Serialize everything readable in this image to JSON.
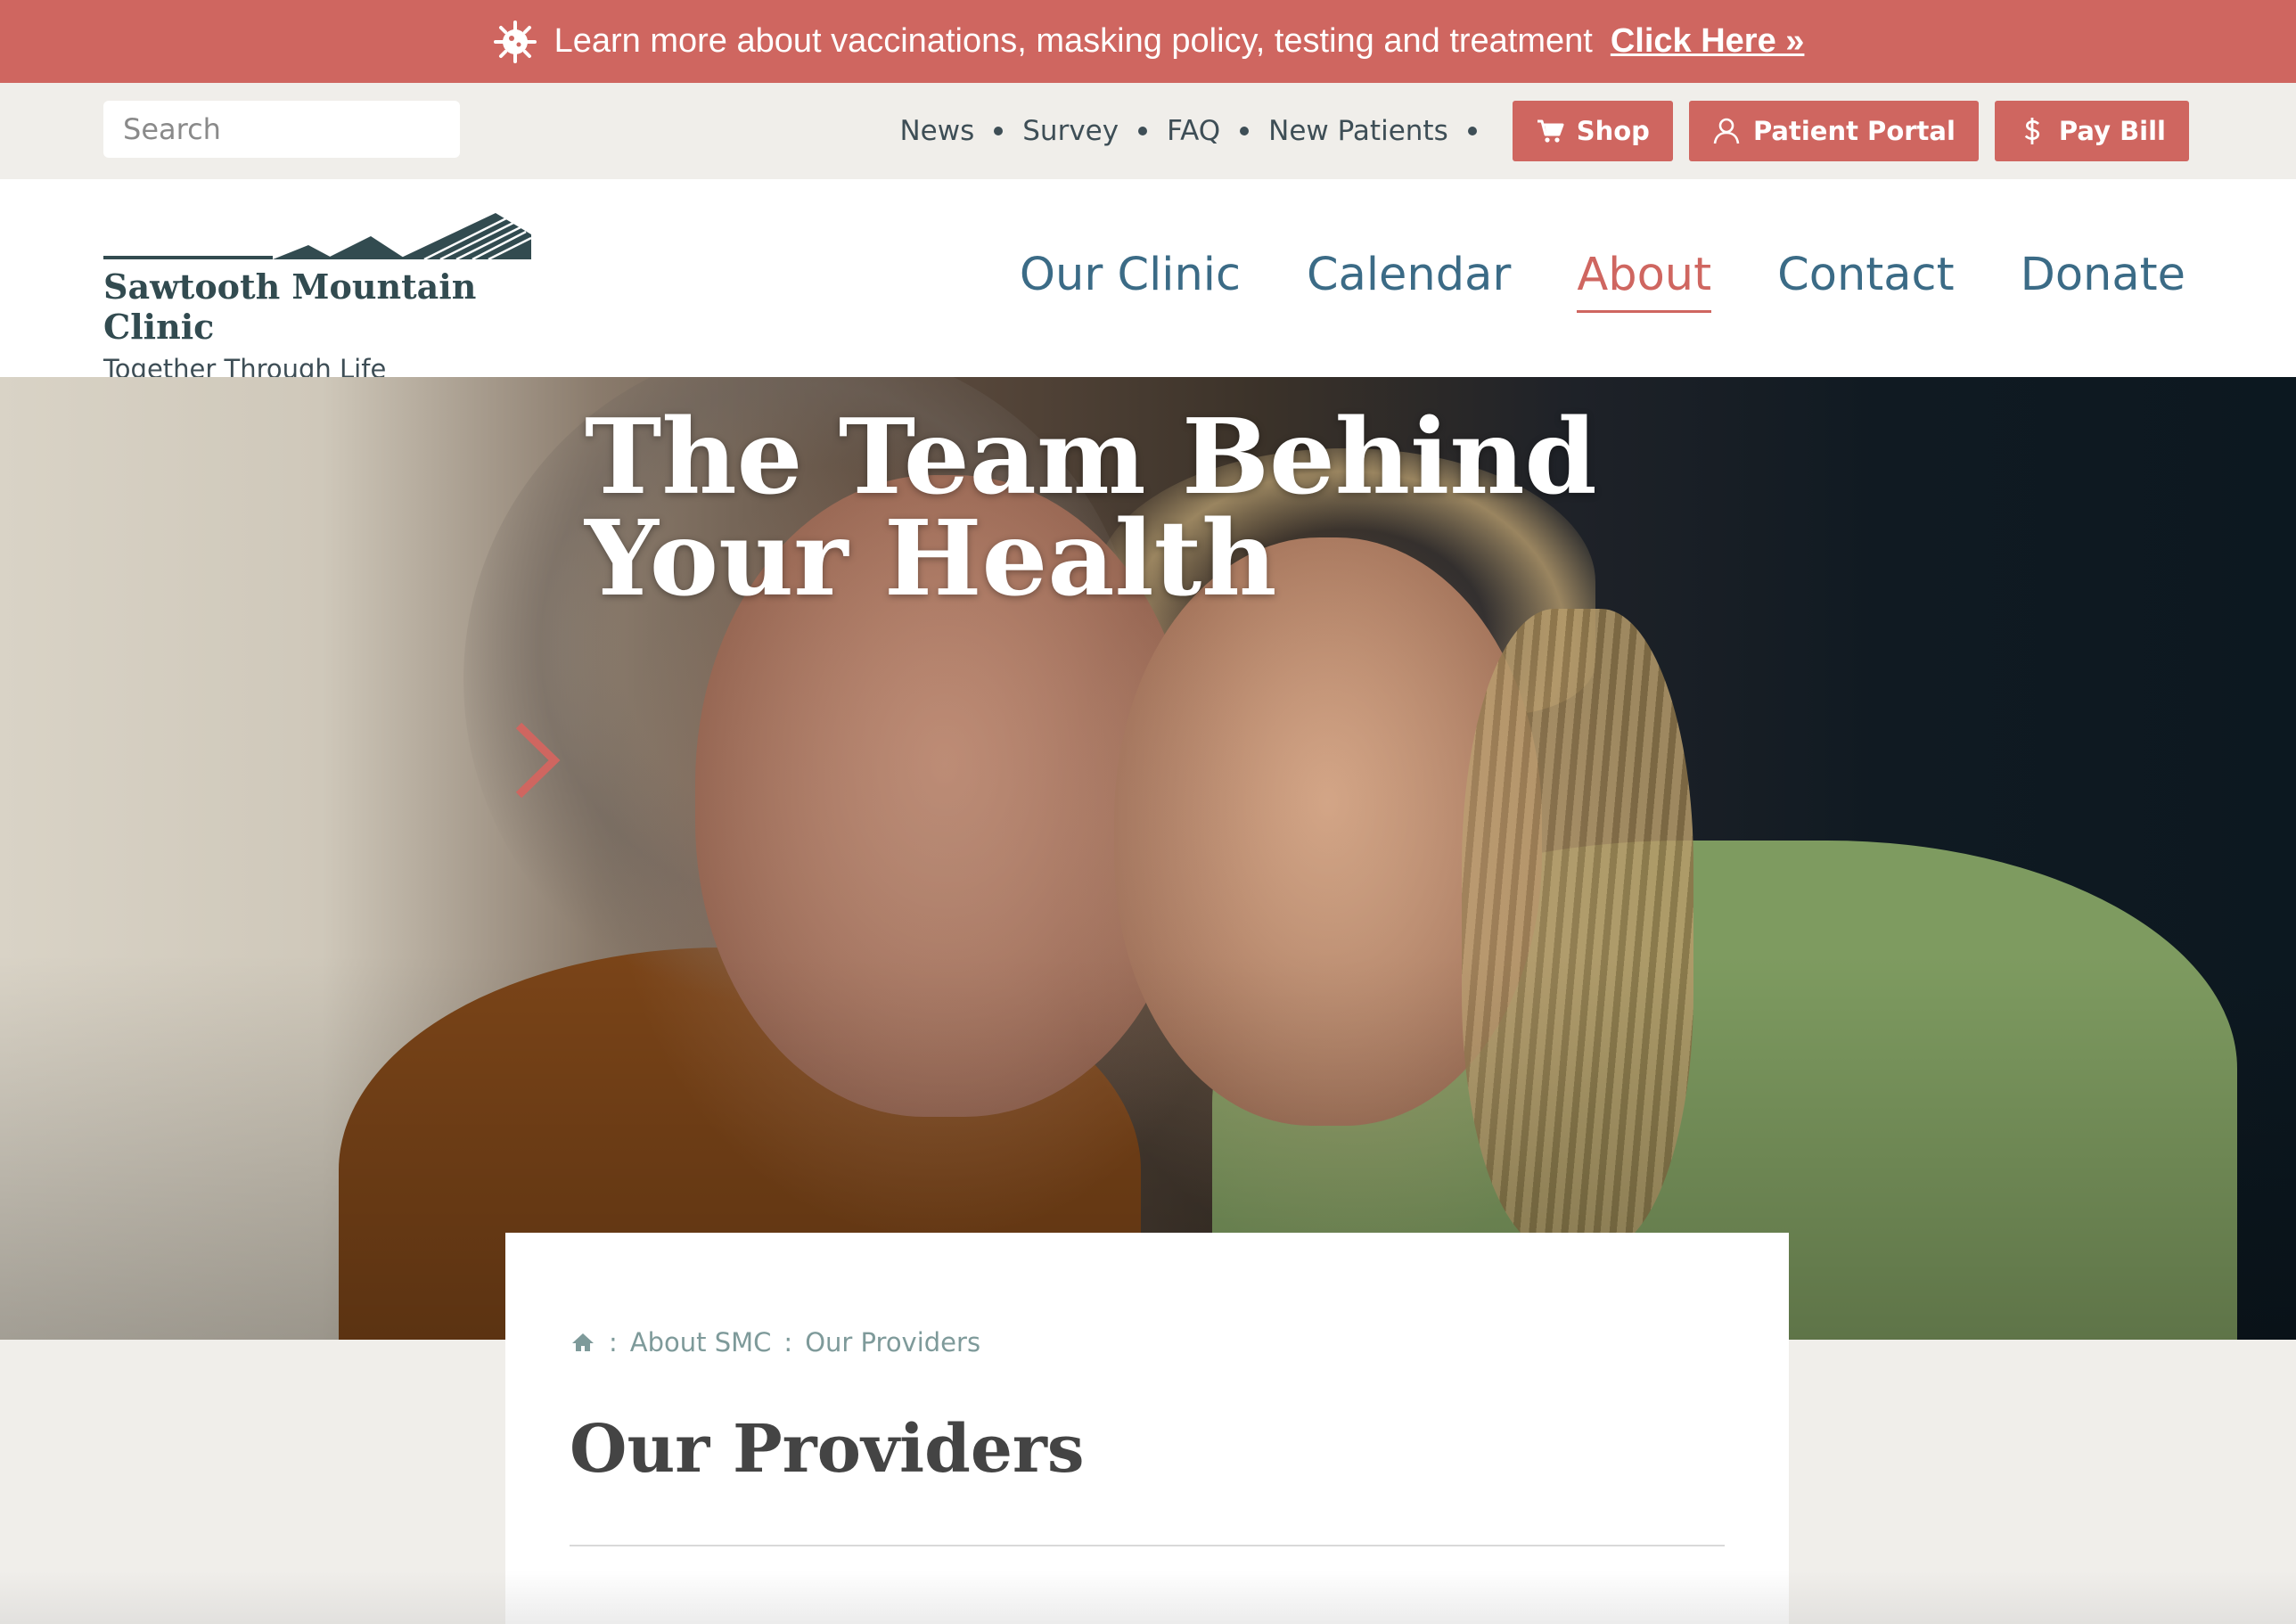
{
  "alert": {
    "text": "Learn more about vaccinations, masking policy, testing and treatment",
    "link_label": "Click Here »",
    "icon": "virus-icon"
  },
  "utility": {
    "search_placeholder": "Search",
    "links": [
      "News",
      "Survey",
      "FAQ",
      "New Patients"
    ],
    "buttons": [
      {
        "label": "Shop",
        "icon": "cart-icon"
      },
      {
        "label": "Patient Portal",
        "icon": "user-icon"
      },
      {
        "label": "Pay Bill",
        "icon": "dollar-icon"
      }
    ]
  },
  "header": {
    "logo_title": "Sawtooth Mountain Clinic",
    "logo_tagline": "Together Through Life",
    "nav": [
      "Our Clinic",
      "Calendar",
      "About",
      "Contact",
      "Donate"
    ],
    "active_nav": "About"
  },
  "hero": {
    "title": "The Team Behind Your Health"
  },
  "content": {
    "breadcrumb": [
      "About SMC",
      "Our Providers"
    ],
    "page_title": "Our Providers"
  },
  "colors": {
    "accent": "#cf6660",
    "nav_blue": "#3b6b86",
    "dark_teal": "#324b50",
    "page_bg": "#f0eeea"
  }
}
